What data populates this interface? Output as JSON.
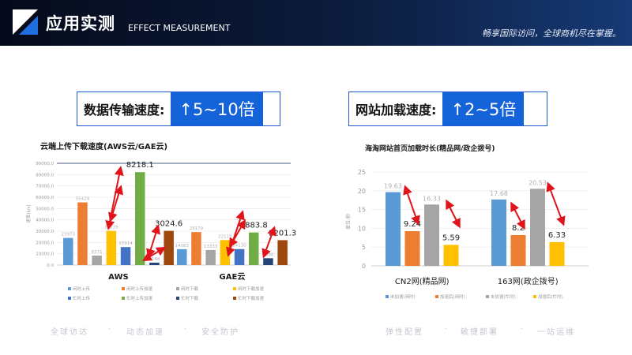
{
  "header": {
    "title": "应用实测",
    "subtitle": "EFFECT MEASUREMENT",
    "slogan": "畅享国际访问，全球商机尽在掌握。"
  },
  "metrics": {
    "left": {
      "label": "数据传输速度:",
      "value": "↑5~10倍"
    },
    "right": {
      "label": "网站加载速度:",
      "value": "↑2~5倍"
    }
  },
  "footer": {
    "items": [
      "全球访达",
      "·",
      "动态加速",
      "·",
      "安全防护",
      "弹性配置",
      "·",
      "敏捷部署",
      "·",
      "一站运维"
    ]
  },
  "chart_data": [
    {
      "type": "bar",
      "title": "云端上传下载速度(AWS云/GAE云)",
      "ylabel": "速率(k/s)",
      "ylim": [
        0,
        90000
      ],
      "yticks": [
        "0.0",
        "10000.0",
        "20000.0",
        "30000.0",
        "40000.0",
        "50000.0",
        "60000.0",
        "70000.0",
        "80000.0",
        "90000.0"
      ],
      "categories": [
        "AWS",
        "GAE云"
      ],
      "series": [
        {
          "name": "闲时上传",
          "color": "#5b9bd5",
          "values": [
            23973,
            14083
          ],
          "labels": [
            "23973",
            "14083"
          ]
        },
        {
          "name": "闲时上传加速",
          "color": "#ed7d31",
          "values": [
            55424,
            29179
          ],
          "labels": [
            "55424",
            "29179"
          ]
        },
        {
          "name": "闲时下载",
          "color": "#a5a5a5",
          "values": [
            8371,
            13333
          ],
          "labels": [
            "8371",
            "13333"
          ]
        },
        {
          "name": "闲时下载加速",
          "color": "#ffc000",
          "values": [
            30239,
            22115
          ],
          "labels": [
            "30239",
            "22115"
          ]
        },
        {
          "name": "忙时上传",
          "color": "#4472c4",
          "values": [
            15914,
            14130
          ],
          "labels": [
            "15914",
            "14130"
          ]
        },
        {
          "name": "忙时上传加速",
          "color": "#70ad47",
          "values": [
            82181,
            28838
          ],
          "labels": [
            "8218.1",
            "2883.8"
          ]
        },
        {
          "name": "忙时下载",
          "color": "#264478",
          "values": [
            2148,
            6046
          ],
          "labels": [
            "2148",
            "6046"
          ]
        },
        {
          "name": "忙时下载加速",
          "color": "#9e480e",
          "values": [
            30246,
            22013
          ],
          "labels": [
            "3024.6",
            "2201.3"
          ]
        }
      ]
    },
    {
      "type": "bar",
      "title": "海淘网站首页加载时长(精品网/政企拨号)",
      "ylabel": "单位:秒",
      "ylim": [
        0,
        25
      ],
      "yticks": [
        "0",
        "5",
        "10",
        "15",
        "20",
        "25"
      ],
      "categories": [
        "CN2网(精品网)",
        "163网(政企拨号)"
      ],
      "series": [
        {
          "name": "未加速(闲时)",
          "color": "#5b9bd5",
          "values": [
            19.63,
            17.68
          ]
        },
        {
          "name": "加速后(闲时)",
          "color": "#ed7d31",
          "values": [
            9.24,
            8.2
          ]
        },
        {
          "name": "未加速(忙时)",
          "color": "#a5a5a5",
          "values": [
            16.33,
            20.53
          ]
        },
        {
          "name": "加速后(忙时)",
          "color": "#ffc000",
          "values": [
            5.59,
            6.33
          ]
        }
      ]
    }
  ]
}
